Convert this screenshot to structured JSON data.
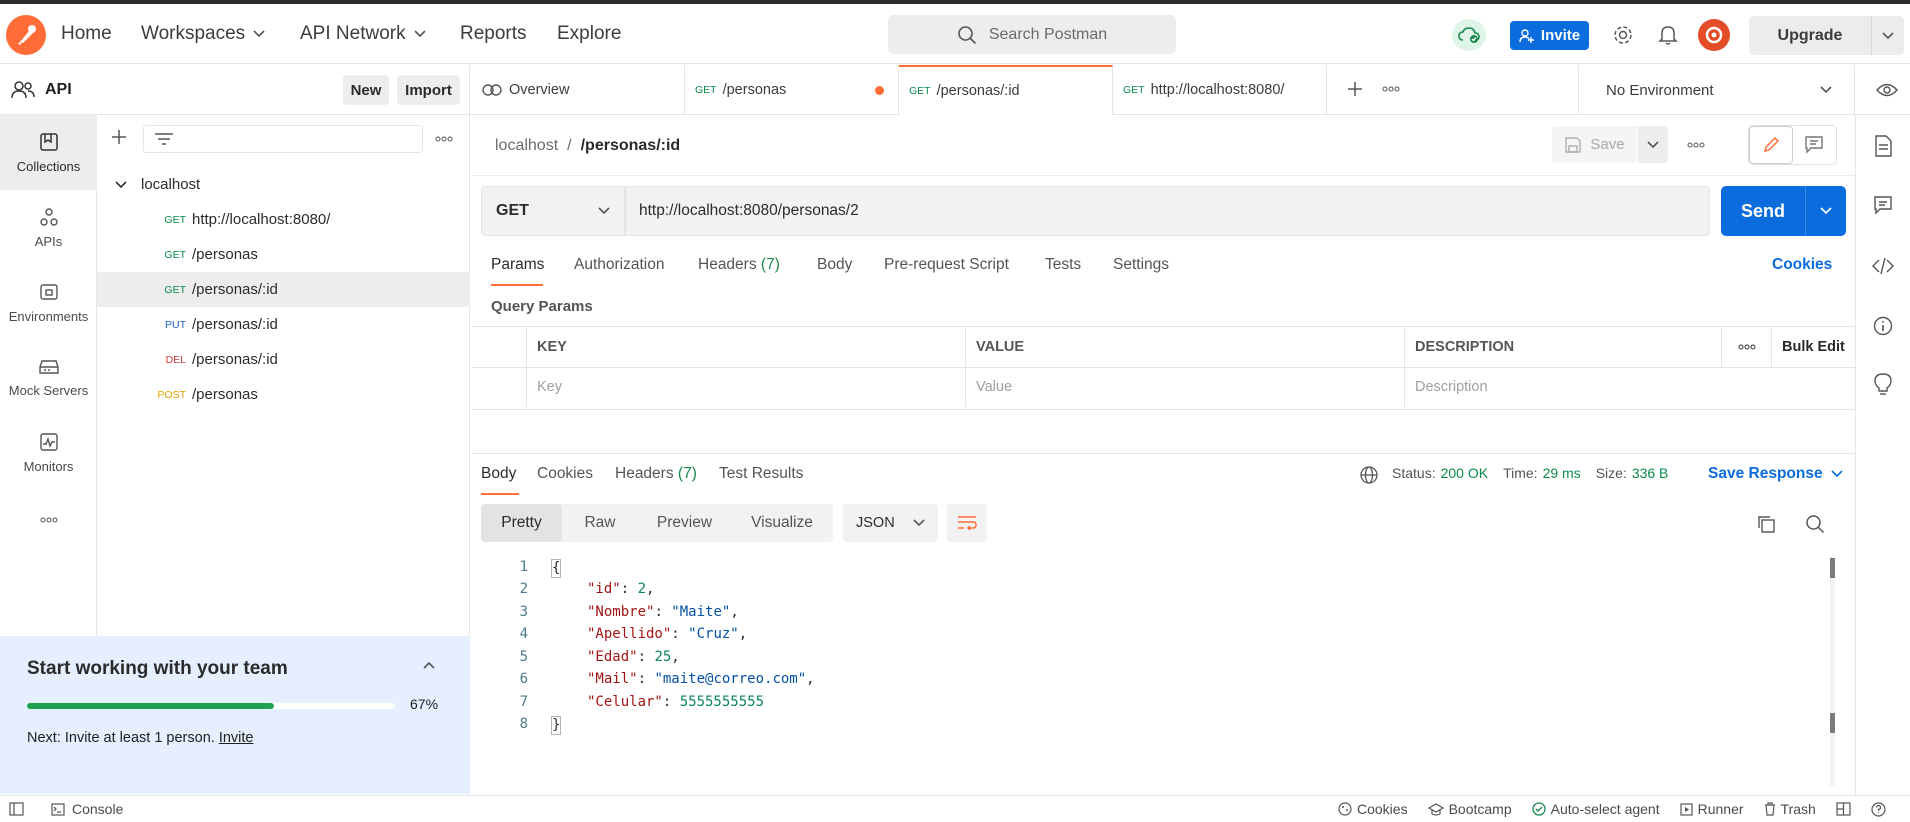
{
  "topbar": {
    "nav": [
      "Home",
      "Workspaces",
      "API Network",
      "Reports",
      "Explore"
    ],
    "search_placeholder": "Search Postman",
    "invite_label": "Invite",
    "upgrade_label": "Upgrade"
  },
  "workspace": {
    "name": "API",
    "new_label": "New",
    "import_label": "Import"
  },
  "rail": [
    "Collections",
    "APIs",
    "Environments",
    "Mock Servers",
    "Monitors"
  ],
  "tree": {
    "collection": "localhost",
    "items": [
      {
        "method": "GET",
        "name": "http://localhost:8080/"
      },
      {
        "method": "GET",
        "name": "/personas"
      },
      {
        "method": "GET",
        "name": "/personas/:id"
      },
      {
        "method": "PUT",
        "name": "/personas/:id"
      },
      {
        "method": "DEL",
        "name": "/personas/:id"
      },
      {
        "method": "POST",
        "name": "/personas"
      }
    ]
  },
  "team_card": {
    "title": "Start working with your team",
    "progress": "67%",
    "progress_fraction": 0.67,
    "next_prefix": "Next: Invite at least 1 person.",
    "next_link": "Invite"
  },
  "tabs": [
    {
      "label": "Overview"
    },
    {
      "method": "GET",
      "label": "/personas"
    },
    {
      "method": "GET",
      "label": "/personas/:id"
    },
    {
      "method": "GET",
      "label": "http://localhost:8080/"
    }
  ],
  "environment": "No Environment",
  "request": {
    "breadcrumb_parent": "localhost",
    "breadcrumb_sep": "/",
    "breadcrumb_current": "/personas/:id",
    "save_label": "Save",
    "method": "GET",
    "url": "http://localhost:8080/personas/2",
    "send_label": "Send",
    "subtabs": [
      "Params",
      "Authorization",
      "Headers",
      "Body",
      "Pre-request Script",
      "Tests",
      "Settings"
    ],
    "headers_count": "(7)",
    "cookies_label": "Cookies",
    "query_params_label": "Query Params",
    "columns": [
      "KEY",
      "VALUE",
      "DESCRIPTION"
    ],
    "bulk_edit_label": "Bulk Edit",
    "placeholders": [
      "Key",
      "Value",
      "Description"
    ]
  },
  "response": {
    "tabs": [
      "Body",
      "Cookies",
      "Headers",
      "Test Results"
    ],
    "headers_count": "(7)",
    "status_label": "Status:",
    "status_value": "200 OK",
    "time_label": "Time:",
    "time_value": "29 ms",
    "size_label": "Size:",
    "size_value": "336 B",
    "save_response_label": "Save Response",
    "view_modes": [
      "Pretty",
      "Raw",
      "Preview",
      "Visualize"
    ],
    "format": "JSON",
    "line_numbers": [
      "1",
      "2",
      "3",
      "4",
      "5",
      "6",
      "7",
      "8"
    ],
    "body": {
      "open": "{",
      "close": "}",
      "fields": [
        {
          "key": "\"id\"",
          "value": "2",
          "type": "number",
          "comma": ","
        },
        {
          "key": "\"Nombre\"",
          "value": "\"Maite\"",
          "type": "string",
          "comma": ","
        },
        {
          "key": "\"Apellido\"",
          "value": "\"Cruz\"",
          "type": "string",
          "comma": ","
        },
        {
          "key": "\"Edad\"",
          "value": "25",
          "type": "number",
          "comma": ","
        },
        {
          "key": "\"Mail\"",
          "value": "\"maite@correo.com\"",
          "type": "string",
          "comma": ","
        },
        {
          "key": "\"Celular\"",
          "value": "5555555555",
          "type": "number",
          "comma": ""
        }
      ]
    }
  },
  "statusbar": {
    "console_label": "Console",
    "right": [
      "Cookies",
      "Bootcamp",
      "Auto-select agent",
      "Runner",
      "Trash"
    ]
  },
  "colors": {
    "brand": "#ff6c37",
    "send": "#0b6cdd",
    "get": "#0a8a4a",
    "put": "#1a63c9",
    "del": "#d13b3b",
    "post": "#e6a100",
    "status_ok": "#0a8a4a"
  },
  "icons": [
    "postman-logo-icon",
    "search-icon",
    "cloud-sync-icon",
    "add-user-icon",
    "gear-icon",
    "bell-icon",
    "avatar-icon",
    "chevron-down-icon",
    "people-icon",
    "collections-icon",
    "apis-icon",
    "environments-icon",
    "mock-servers-icon",
    "monitors-icon",
    "more-icon",
    "plus-icon",
    "filter-icon",
    "overview-icon",
    "eye-icon",
    "save-icon",
    "edit-icon",
    "comment-icon",
    "globe-icon",
    "copy-icon",
    "wrap-icon",
    "document-icon",
    "code-icon",
    "info-icon",
    "lightbulb-icon",
    "console-icon",
    "layout-icon",
    "help-icon"
  ]
}
